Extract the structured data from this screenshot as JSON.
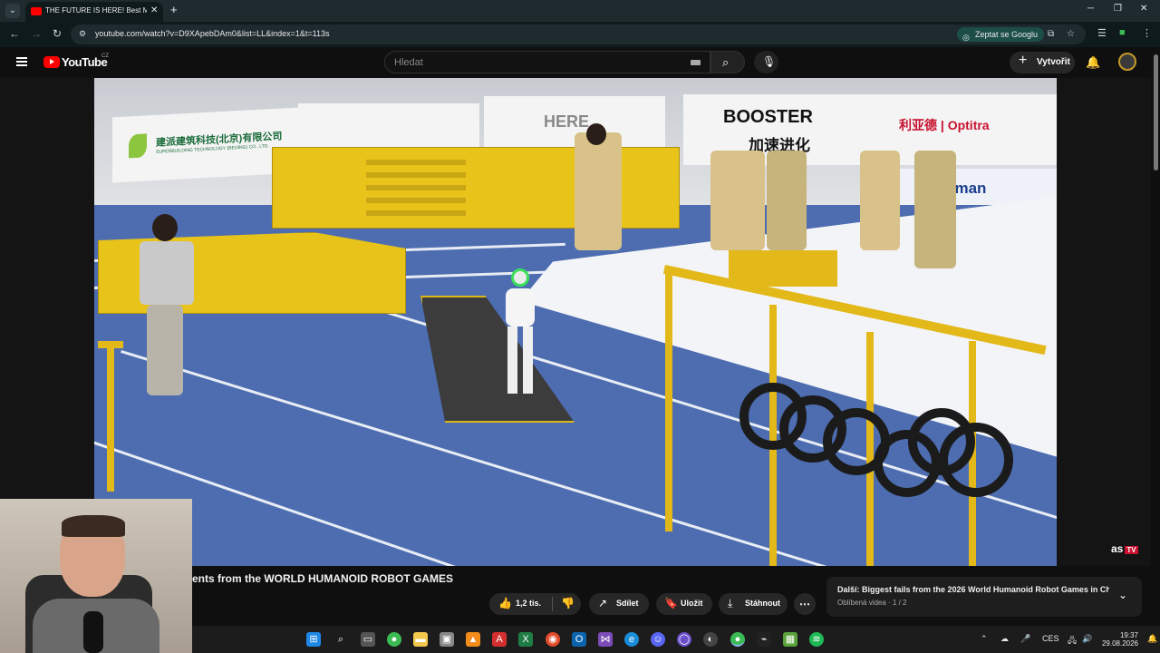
{
  "browser": {
    "tab_title": "THE FUTURE IS HERE! Best Mo",
    "url": "youtube.com/watch?v=D9XApebDAm0&list=LL&index=1&t=113s",
    "google_chip": "Zeptat se Googlu"
  },
  "youtube": {
    "logo": "YouTube",
    "region": "CZ",
    "search_placeholder": "Hledat",
    "create_label": "Vytvořit"
  },
  "video": {
    "title_visible": "ents from the WORLD HUMANOID ROBOT GAMES",
    "watermark": "as",
    "watermark_badge": "TV",
    "scene": {
      "board_left": "建派建筑科技(北京)有限公司",
      "board_left_sub": "SUPERBUILDING TECHNOLOGY (BEIJING) CO., LTD.",
      "board_here": "HERE",
      "board_booster": "BOOSTER",
      "board_booster_cn": "加速进化",
      "board_right": "利亚德 | Optitra",
      "board_mid": "aman"
    }
  },
  "actions": {
    "like_count": "1,2 tis.",
    "share": "Sdílet",
    "save": "Uložit",
    "download": "Stáhnout",
    "more": "⋯"
  },
  "next_up": {
    "title": "Další: Biggest fails from the 2026 World Humanoid Robot Games in Ch...",
    "subtitle": "Oblíbená videa · 1 / 2"
  },
  "taskbar": {
    "lang": "CES",
    "time": "19:37",
    "date": "29.08.2026"
  },
  "colors": {
    "yt_red": "#ff0000",
    "track_blue": "#4d6db0",
    "obstacle_yellow": "#e8c41a",
    "chip_teal": "#1d4d47"
  }
}
